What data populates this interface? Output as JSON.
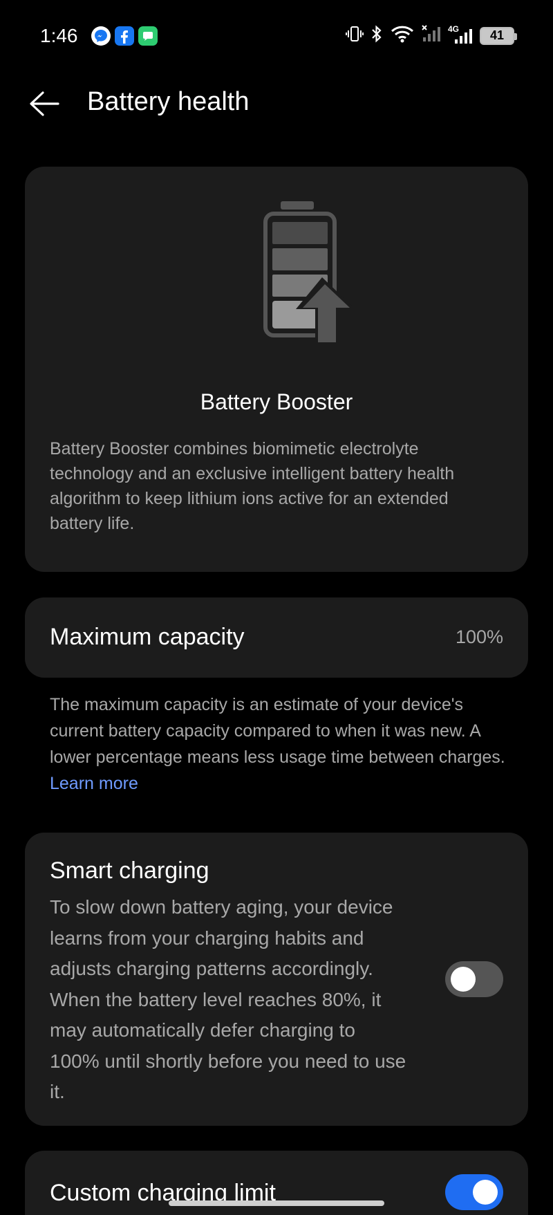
{
  "status_bar": {
    "time": "1:46",
    "network": "4G",
    "battery": "41",
    "icons": [
      "messenger-icon",
      "facebook-icon",
      "messages-icon",
      "vibrate-icon",
      "bluetooth-icon",
      "wifi-icon",
      "signal-icon",
      "battery-icon"
    ]
  },
  "header": {
    "title": "Battery health"
  },
  "booster": {
    "title": "Battery Booster",
    "description": "Battery Booster combines biomimetic electrolyte technology and an exclusive intelligent battery health algorithm to keep lithium ions active for an extended battery life."
  },
  "capacity": {
    "label": "Maximum capacity",
    "value": "100%",
    "help": "The maximum capacity is an estimate of your device's current battery capacity compared to when it was new. A lower percentage means less usage time between charges.",
    "learn_more": "Learn more"
  },
  "smart_charging": {
    "title": "Smart charging",
    "description": "To slow down battery aging, your device learns from your charging habits and adjusts charging patterns accordingly. When the battery level reaches 80%, it may automatically defer charging to 100% until shortly before you need to use it.",
    "enabled": false
  },
  "custom_limit": {
    "title": "Custom charging limit",
    "enabled": true
  },
  "colors": {
    "background": "#000000",
    "card": "#1c1c1c",
    "accent": "#1f6df2",
    "link": "#6f9bff",
    "secondary_text": "#a8a8a8"
  }
}
